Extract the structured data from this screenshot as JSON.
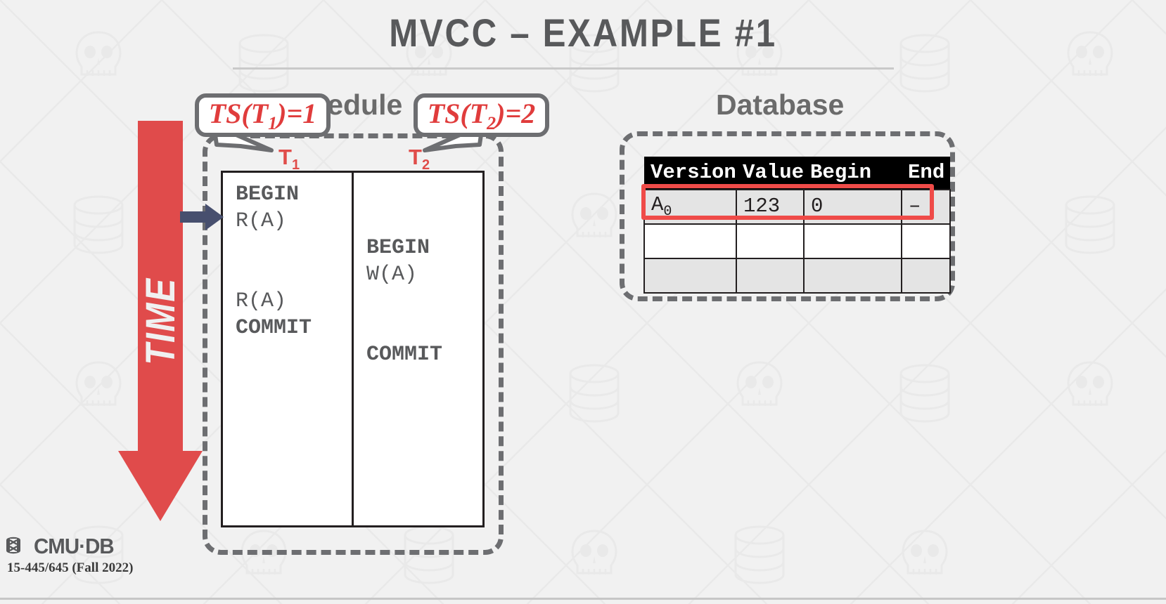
{
  "slide": {
    "title": "MVCC – EXAMPLE #1",
    "accent_red": "#e03c3c",
    "time_arrow_color": "#e04b4b",
    "pointer_color": "#474f6e",
    "dash_color": "#6d6e71",
    "heading_color": "#6b6b6b"
  },
  "time_axis": {
    "label": "TIME"
  },
  "schedule": {
    "heading": "Schedule",
    "transactions": [
      {
        "label": "T",
        "subscript": "1",
        "name": "t1",
        "operations": [
          {
            "text": "BEGIN",
            "bold": true
          },
          {
            "text": "R(A)",
            "bold": false
          },
          {
            "text": "",
            "bold": false
          },
          {
            "text": "",
            "bold": false
          },
          {
            "text": "R(A)",
            "bold": false
          },
          {
            "text": "COMMIT",
            "bold": true
          }
        ]
      },
      {
        "label": "T",
        "subscript": "2",
        "name": "t2",
        "operations": [
          {
            "text": "",
            "bold": false
          },
          {
            "text": "",
            "bold": false
          },
          {
            "text": "BEGIN",
            "bold": true
          },
          {
            "text": "W(A)",
            "bold": false
          },
          {
            "text": "",
            "bold": false
          },
          {
            "text": "",
            "bold": false
          },
          {
            "text": "COMMIT",
            "bold": true
          }
        ]
      }
    ]
  },
  "callouts": [
    {
      "prefix": "TS(T",
      "subscript": "1",
      "suffix": ")=1"
    },
    {
      "prefix": "TS(T",
      "subscript": "2",
      "suffix": ")=2"
    }
  ],
  "database": {
    "heading": "Database",
    "columns": [
      "Version",
      "Value",
      "Begin",
      "End"
    ],
    "rows": [
      {
        "cells": [
          {
            "text": "A",
            "subscript": "0"
          },
          {
            "text": "123",
            "subscript": ""
          },
          {
            "text": "0",
            "subscript": ""
          },
          {
            "text": "–",
            "subscript": ""
          }
        ],
        "shaded": true,
        "highlighted": true
      },
      {
        "cells": [
          {
            "text": "",
            "subscript": ""
          },
          {
            "text": "",
            "subscript": ""
          },
          {
            "text": "",
            "subscript": ""
          },
          {
            "text": "",
            "subscript": ""
          }
        ],
        "shaded": false,
        "highlighted": false
      },
      {
        "cells": [
          {
            "text": "",
            "subscript": ""
          },
          {
            "text": "",
            "subscript": ""
          },
          {
            "text": "",
            "subscript": ""
          },
          {
            "text": "",
            "subscript": ""
          }
        ],
        "shaded": true,
        "highlighted": false
      }
    ]
  },
  "footer": {
    "logo_text": "CMU·DB",
    "course": "15-445/645 (Fall 2022)"
  }
}
